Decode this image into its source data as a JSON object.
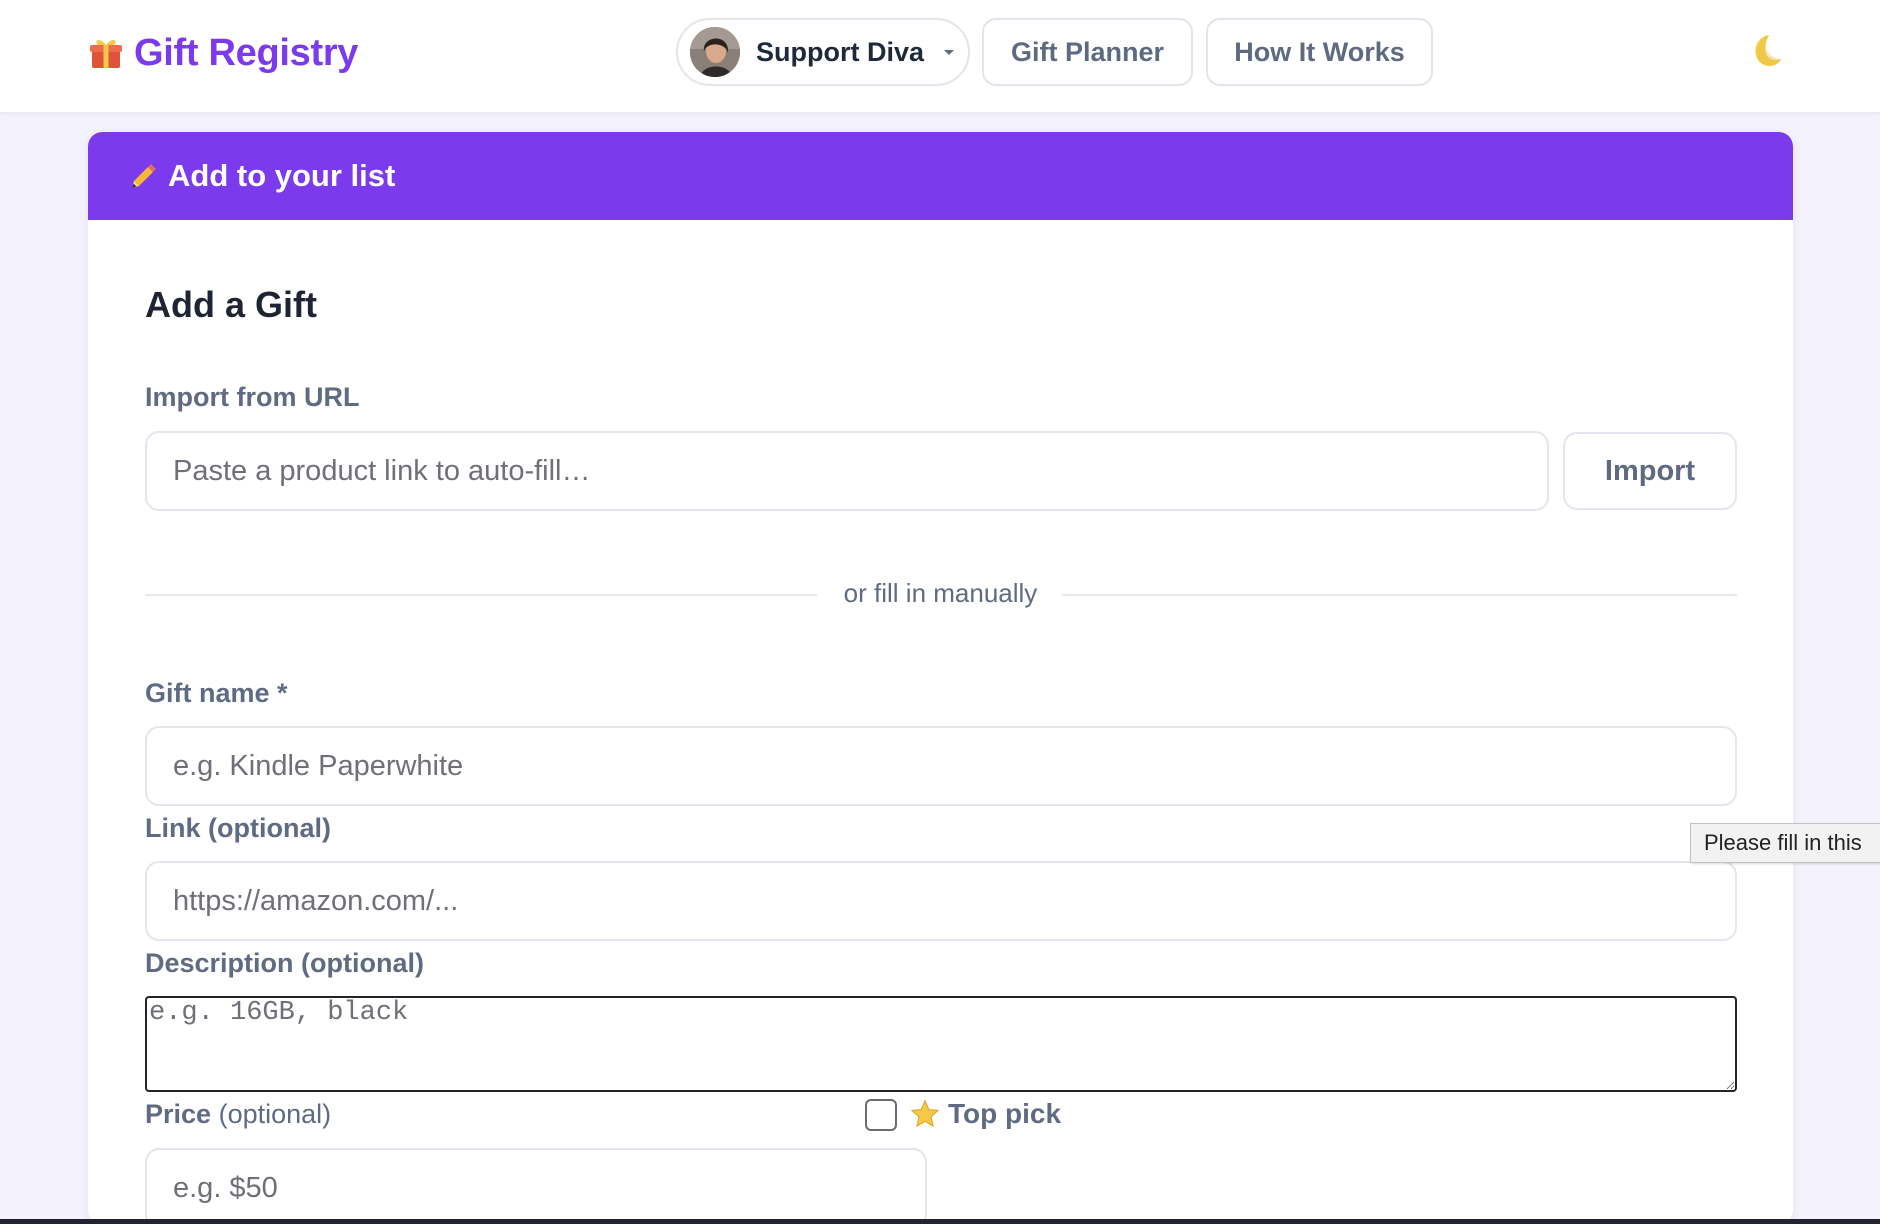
{
  "header": {
    "logo_text": "Gift Registry",
    "user_label": "Support Diva",
    "nav": {
      "planner_label": "Gift Planner",
      "how_label": "How It Works"
    },
    "icons": {
      "logo": "gift-icon",
      "user_menu": "chevron-down-icon",
      "theme": "moon-icon"
    }
  },
  "card": {
    "banner_title": "Add to your list",
    "banner_icon": "pencil-icon",
    "title": "Add a Gift",
    "import": {
      "label": "Import from URL",
      "placeholder": "Paste a product link to auto-fill…",
      "button_label": "Import"
    },
    "divider_text": "or fill in manually",
    "gift_name": {
      "label": "Gift name *",
      "placeholder": "e.g. Kindle Paperwhite"
    },
    "link": {
      "label": "Link (optional)",
      "placeholder": "https://amazon.com/..."
    },
    "description": {
      "label": "Description (optional)",
      "placeholder": "e.g. 16GB, black"
    },
    "price": {
      "label": "Price",
      "label_suffix": "(optional)",
      "placeholder": "e.g. $50"
    },
    "top_pick": {
      "label": "Top pick",
      "icon": "star-icon",
      "checked": false
    }
  },
  "tooltip": {
    "text": "Please fill in this"
  },
  "colors": {
    "brand": "#7c3aed",
    "background": "#f4f2fd",
    "muted_text": "#5f6b82"
  }
}
